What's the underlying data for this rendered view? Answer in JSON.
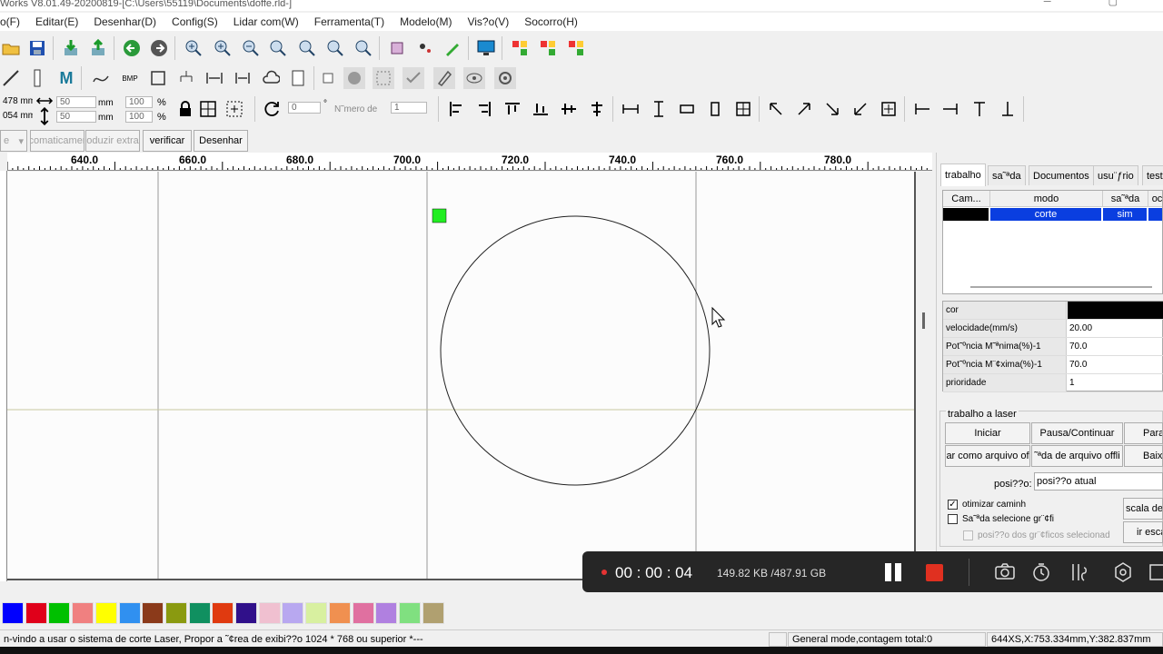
{
  "window": {
    "title": "Works V8.01.49-20200819-[C:\\Users\\55119\\Documents\\doffe.rld-]"
  },
  "menu": [
    "o(F)",
    "Editar(E)",
    "Desenhar(D)",
    "Config(S)",
    "Lidar com(W)",
    "Ferramenta(T)",
    "Modelo(M)",
    "Vis?o(V)",
    "Socorro(H)"
  ],
  "size_panel": {
    "x_value": "478 mm",
    "y_value": "054 mm",
    "width_value": "50",
    "height_value": "50",
    "unit": "mm",
    "scale_w": "100",
    "scale_h": "100",
    "percent": "%"
  },
  "rotate": {
    "angle_value": "0",
    "degree_symbol": "°",
    "number_label": "N˜mero de",
    "number_value": "1"
  },
  "toolbar3": {
    "dropdown_value": "e",
    "auto_label": "comaticamer",
    "reduce_label": "oduzir extra",
    "verify_label": "verificar",
    "draw_label": "Desenhar"
  },
  "ruler": {
    "labels": [
      "640.0",
      "660.0",
      "680.0",
      "700.0",
      "720.0",
      "740.0",
      "760.0",
      "780.0"
    ]
  },
  "right_panel": {
    "tabs": [
      "trabalho",
      "sa˜ªda",
      "Documentos",
      "usu¨ƒrio",
      "testa"
    ],
    "grid_headers": [
      "Cam...",
      "modo",
      "sa˜ªda",
      "oc"
    ],
    "grid_row": {
      "mode": "corte",
      "output": "sim"
    },
    "properties": [
      {
        "key": "cor",
        "value": ""
      },
      {
        "key": "velocidade(mm/s)",
        "value": "20.00"
      },
      {
        "key": "Pot˜ºncia M˜ªnima(%)-1",
        "value": "70.0"
      },
      {
        "key": "Pot˜ºncia M¨¢xima(%)-1",
        "value": "70.0"
      },
      {
        "key": "prioridade",
        "value": "1"
      }
    ],
    "laser_job": {
      "title": "trabalho a laser",
      "start": "Iniciar",
      "pause": "Pausa/Continuar",
      "stop": "Para",
      "save_offline": "ar como arquivo of",
      "offline_output": "˜ªda de arquivo offli",
      "download": "Baix",
      "position_label": "posi??o:",
      "position_value": "posi??o atual",
      "optimize_label": "otimizar caminh",
      "optimize_checked": true,
      "output_selected_label": "Sa˜ªda selecione gr¨¢fi",
      "output_selected_checked": false,
      "position_selected_label": "posi??o dos gr¨¢ficos selecionad",
      "scale_label": "scala de",
      "go_scale_label": "ir esca"
    }
  },
  "palette": [
    "#0000ff",
    "#e0001a",
    "#00c000",
    "#f08080",
    "#ffff00",
    "#3090f0",
    "#8b3a1a",
    "#8a9a10",
    "#109060",
    "#e03a10",
    "#30108a",
    "#f0c0d0",
    "#b8a8f0",
    "#d8f0a0",
    "#f09050",
    "#e070a0",
    "#b080e0",
    "#80e080",
    "#b0a070"
  ],
  "status": {
    "welcome": "n-vindo a usar o sistema de corte Laser, Propor a ˜¢rea de exibi??o 1024 * 768 ou superior *---",
    "mode": "General mode,contagem total:0",
    "coords": "644XS,X:753.334mm,Y:382.837mm"
  },
  "recorder": {
    "time": "00 : 00 : 04",
    "size": "149.82 KB /487.91 GB"
  }
}
